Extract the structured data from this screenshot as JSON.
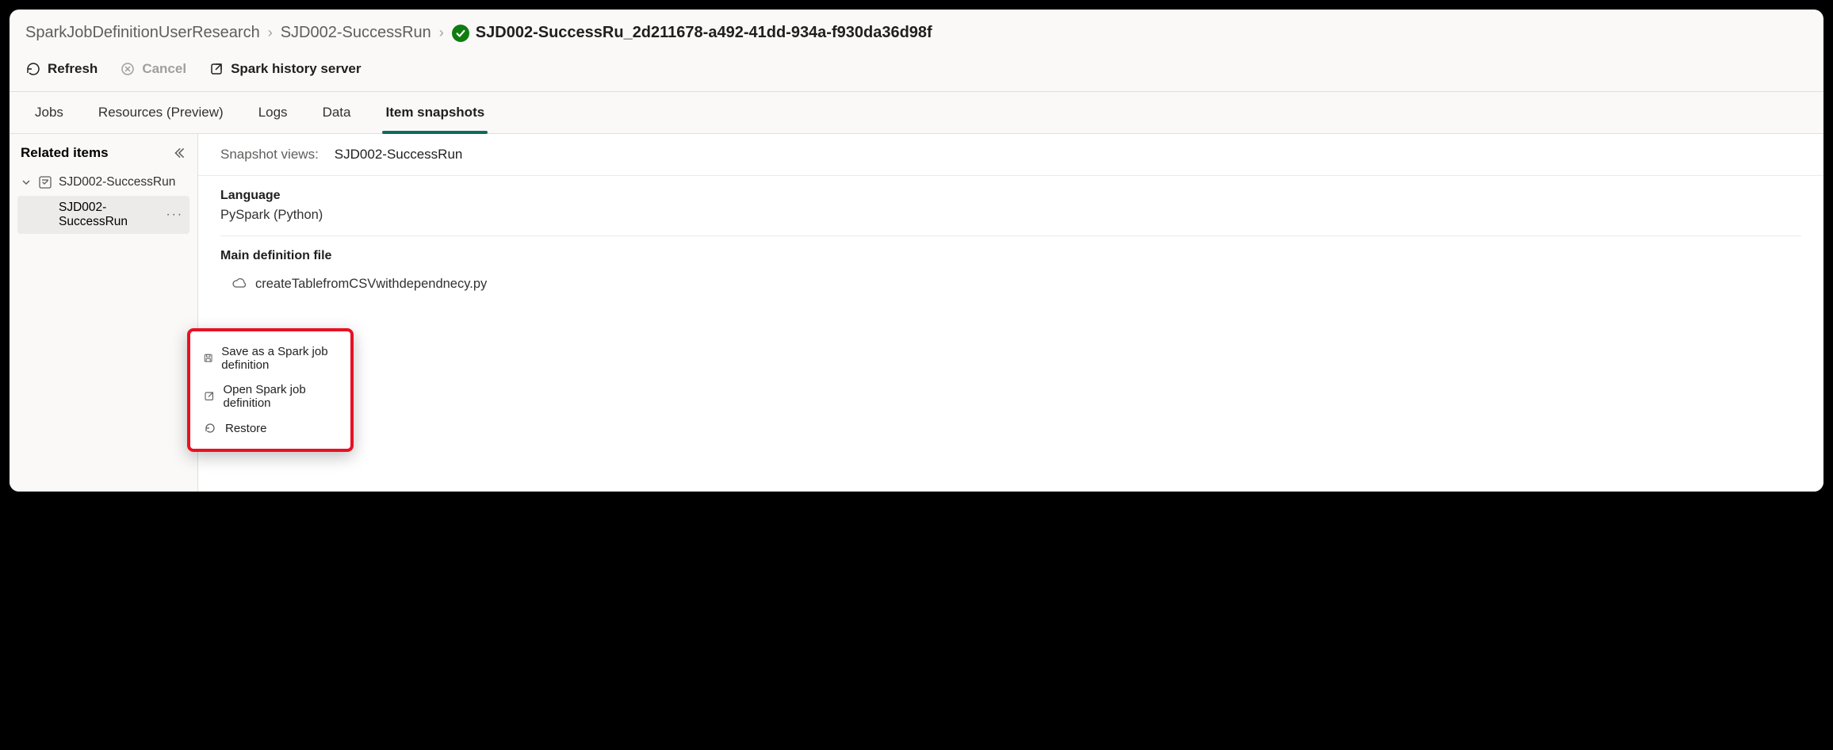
{
  "breadcrumb": {
    "level1": "SparkJobDefinitionUserResearch",
    "level2": "SJD002-SuccessRun",
    "current": "SJD002-SuccessRu_2d211678-a492-41dd-934a-f930da36d98f"
  },
  "toolbar": {
    "refresh": "Refresh",
    "cancel": "Cancel",
    "history": "Spark history server"
  },
  "tabs": {
    "jobs": "Jobs",
    "resources": "Resources (Preview)",
    "logs": "Logs",
    "data": "Data",
    "snapshots": "Item snapshots"
  },
  "sidepane": {
    "title": "Related items",
    "parent": "SJD002-SuccessRun",
    "child": "SJD002-SuccessRun"
  },
  "contextMenu": {
    "saveAs": "Save as a Spark job definition",
    "open": "Open Spark job definition",
    "restore": "Restore"
  },
  "snapshot": {
    "viewsLabel": "Snapshot views:",
    "viewsValue": "SJD002-SuccessRun",
    "languageLabel": "Language",
    "languageValue": "PySpark (Python)",
    "mainFileLabel": "Main definition file",
    "mainFileValue": "createTablefromCSVwithdependnecy.py"
  }
}
